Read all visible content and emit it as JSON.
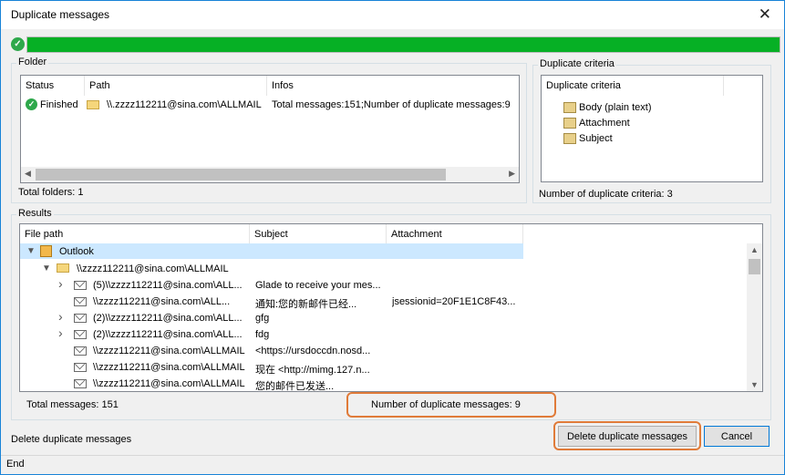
{
  "window": {
    "title": "Duplicate messages",
    "close_glyph": "✕"
  },
  "progress": {
    "value": 1.0,
    "check_glyph": "✓",
    "color": "#06b025"
  },
  "folder_group": {
    "label": "Folder",
    "columns": [
      "Status",
      "Path",
      "Infos"
    ],
    "row": {
      "status": "Finished",
      "path": "\\\\.zzzz112211@sina.com\\ALLMAIL",
      "infos": "Total messages:151;Number of duplicate messages:9"
    },
    "total_folders": "Total folders: 1"
  },
  "criteria_group": {
    "label": "Duplicate criteria",
    "header": "Duplicate criteria",
    "items": [
      "Body (plain text)",
      "Attachment",
      "Subject"
    ],
    "count_text": "Number of duplicate criteria: 3"
  },
  "results_group": {
    "label": "Results",
    "columns": [
      "File path",
      "Subject",
      "Attachment"
    ],
    "root": "Outlook",
    "account": "\\\\zzzz112211@sina.com\\ALLMAIL",
    "rows": [
      {
        "path": "(5)\\\\zzzz112211@sina.com\\ALL...",
        "subject": "Glade to receive your mes...",
        "attachment": "",
        "expandable": true
      },
      {
        "path": "\\\\zzzz112211@sina.com\\ALL...",
        "subject": "通知:您的新邮件已经...",
        "attachment": "jsessionid=20F1E1C8F43...",
        "expandable": false
      },
      {
        "path": "(2)\\\\zzzz112211@sina.com\\ALL...",
        "subject": "gfg",
        "attachment": "",
        "expandable": true
      },
      {
        "path": "(2)\\\\zzzz112211@sina.com\\ALL...",
        "subject": "fdg",
        "attachment": "",
        "expandable": true
      },
      {
        "path": "\\\\zzzz112211@sina.com\\ALLMAIL",
        "subject": "<https://ursdoccdn.nosd...",
        "attachment": "",
        "expandable": false
      },
      {
        "path": "\\\\zzzz112211@sina.com\\ALLMAIL",
        "subject": "现在 <http://mimg.127.n...",
        "attachment": "",
        "expandable": false
      },
      {
        "path": "\\\\zzzz112211@sina.com\\ALLMAIL",
        "subject": "您的邮件已发送...",
        "attachment": "",
        "expandable": false
      }
    ],
    "total_messages": "Total messages: 151",
    "duplicate_messages": "Number of duplicate messages: 9"
  },
  "footer": {
    "hint": "Delete duplicate messages",
    "delete_button": "Delete duplicate messages",
    "cancel_button": "Cancel",
    "status": "End"
  },
  "colors": {
    "accent": "#0078d7",
    "highlight": "#e07b39",
    "selection": "#cce8ff"
  }
}
